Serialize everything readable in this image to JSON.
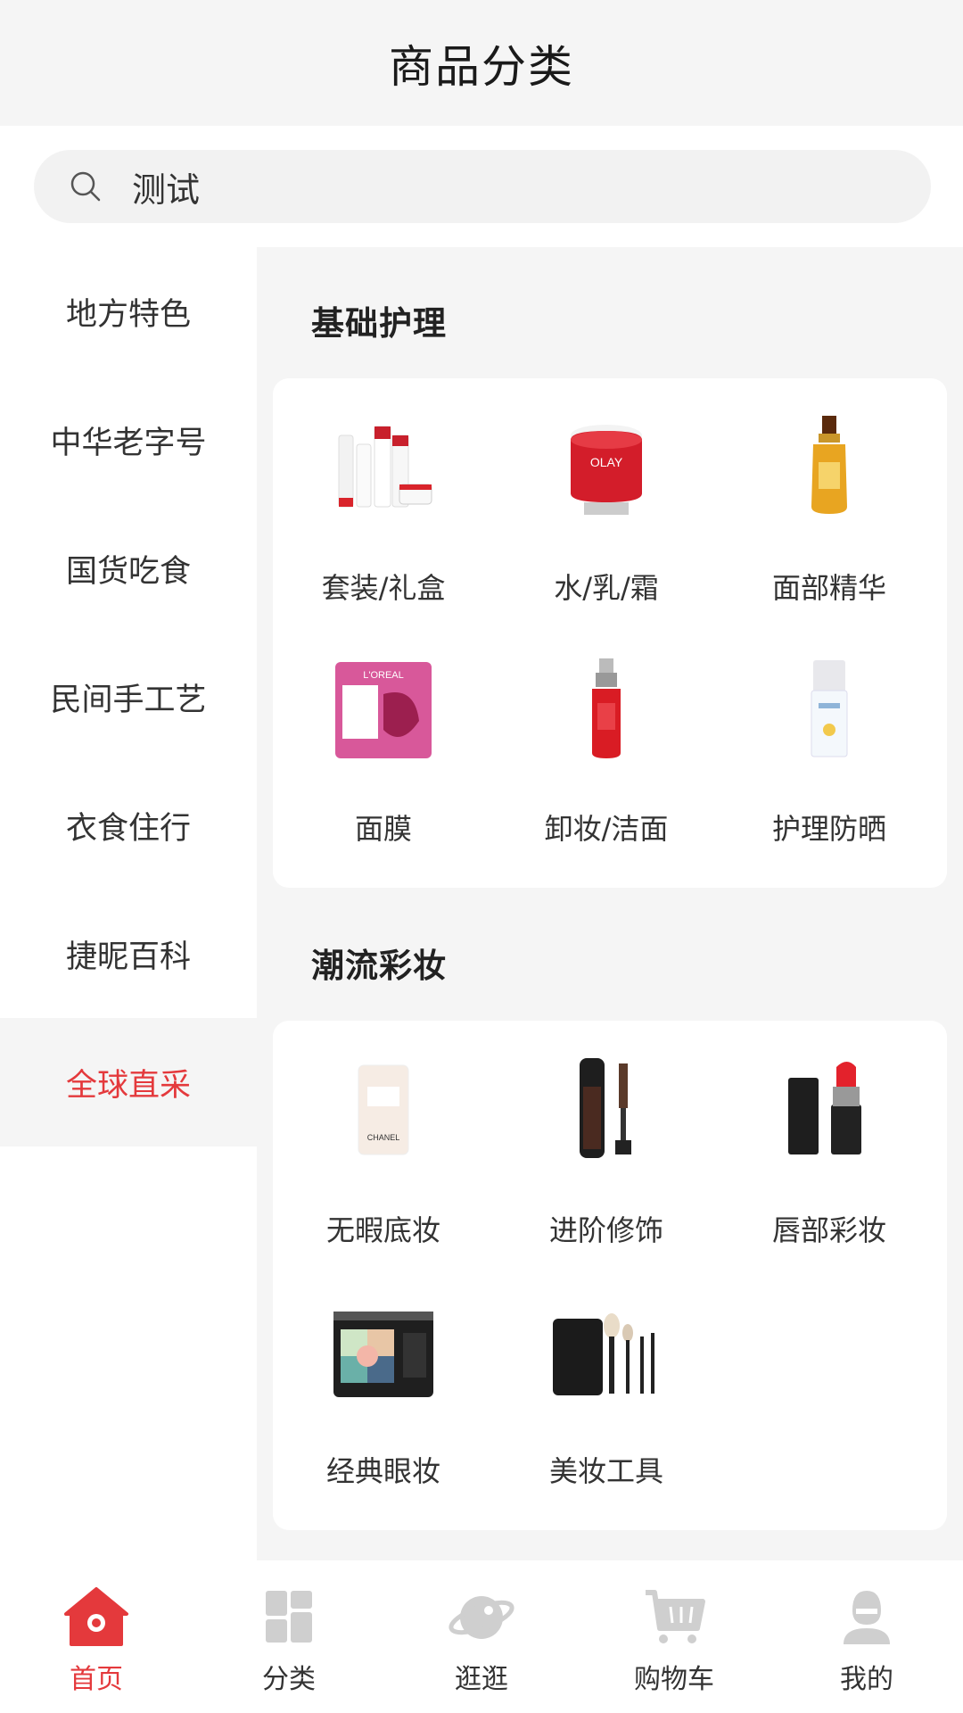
{
  "header": {
    "title": "商品分类"
  },
  "search": {
    "value": "测试"
  },
  "sidebar": {
    "items": [
      {
        "label": "地方特色",
        "active": false
      },
      {
        "label": "中华老字号",
        "active": false
      },
      {
        "label": "国货吃食",
        "active": false
      },
      {
        "label": "民间手工艺",
        "active": false
      },
      {
        "label": "衣食住行",
        "active": false
      },
      {
        "label": "捷昵百科",
        "active": false
      },
      {
        "label": "全球直采",
        "active": true
      }
    ]
  },
  "sections": [
    {
      "title": "基础护理",
      "items": [
        {
          "label": "套装/礼盒",
          "icon": "skincare-set-image"
        },
        {
          "label": "水/乳/霜",
          "icon": "face-cream-jar-image"
        },
        {
          "label": "面部精华",
          "icon": "serum-bottle-image"
        },
        {
          "label": "面膜",
          "icon": "face-mask-pack-image"
        },
        {
          "label": "卸妆/洁面",
          "icon": "cleanser-bottle-image"
        },
        {
          "label": "护理防晒",
          "icon": "sunscreen-bottle-image"
        }
      ]
    },
    {
      "title": "潮流彩妆",
      "items": [
        {
          "label": "无暇底妆",
          "icon": "foundation-bottle-image"
        },
        {
          "label": "进阶修饰",
          "icon": "lip-liquid-image"
        },
        {
          "label": "唇部彩妆",
          "icon": "lipstick-image"
        },
        {
          "label": "经典眼妆",
          "icon": "eyeshadow-palette-image"
        },
        {
          "label": "美妆工具",
          "icon": "makeup-brush-set-image"
        }
      ]
    }
  ],
  "tabbar": {
    "items": [
      {
        "label": "首页",
        "icon": "home-icon",
        "active": true
      },
      {
        "label": "分类",
        "icon": "category-icon",
        "active": false
      },
      {
        "label": "逛逛",
        "icon": "planet-icon",
        "active": false
      },
      {
        "label": "购物车",
        "icon": "cart-icon",
        "active": false
      },
      {
        "label": "我的",
        "icon": "user-icon",
        "active": false
      }
    ]
  },
  "colors": {
    "accent": "#e4393c",
    "background": "#f5f5f5",
    "card": "#ffffff",
    "inactive_icon": "#cfcfcf"
  }
}
